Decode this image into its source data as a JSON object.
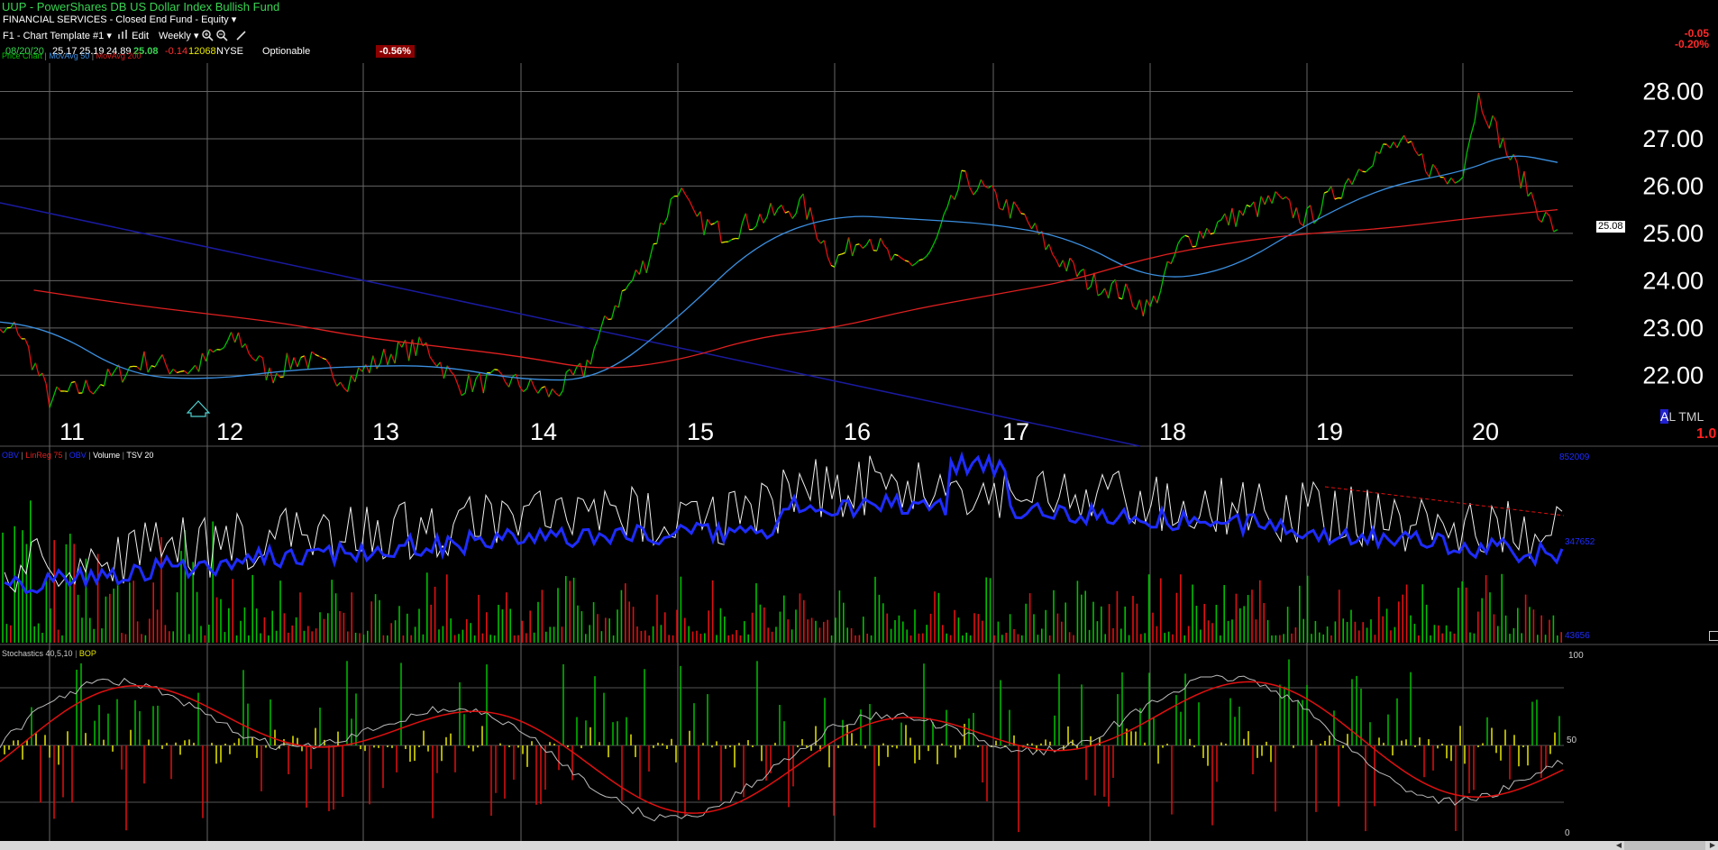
{
  "header": {
    "title": "UUP - PowerShares DB US Dollar Index Bullish Fund",
    "sector": "FINANCIAL SERVICES - Closed End Fund - Equity",
    "template": "F1 - Chart Template #1",
    "edit_label": "Edit",
    "period": "Weekly",
    "date": "08/20/20",
    "open": "25.17",
    "high": "25.19",
    "low": "24.89",
    "close": "25.08",
    "change": "-0.14",
    "volume": "12068",
    "exchange": "NYSE",
    "optionable": "Optionable",
    "pct_change": "-0.56%",
    "right_change": "-0.05",
    "right_pct": "-0.20%",
    "sector_dropdown": "▾",
    "template_dropdown": "▾",
    "period_dropdown": "▾"
  },
  "colors": {
    "up": "#00c000",
    "down": "#e01010",
    "neutral": "#e8e800",
    "ma50": "#3b8fe0",
    "ma200": "#e02020",
    "obv": "#1e2cff",
    "trend": "#1a1aa0"
  },
  "price_panel": {
    "legend": {
      "price": "Price Chart",
      "ma50": "MovAvg 50",
      "ma200": "MovAvg 200"
    },
    "last_price_tag": "25.08",
    "ticker_tag_a": "A",
    "ticker_tag_rest": "L TML",
    "ticker_tag_num": "1.0"
  },
  "volume_panel": {
    "legend": {
      "obv1": "OBV",
      "linreg": "LinReg 75",
      "obv2": "OBV",
      "volume": "Volume",
      "tsv": "TSV 20"
    },
    "top_label": "852009",
    "mid_label": "347652",
    "bottom_label": "43656"
  },
  "stoch_panel": {
    "legend": {
      "stoch": "Stochastics 40,5,10",
      "bop": "BOP"
    },
    "levels": [
      "100",
      "50",
      "0"
    ]
  },
  "chart_data": {
    "type": "line",
    "x_ticks": [
      "11",
      "12",
      "13",
      "14",
      "15",
      "16",
      "17",
      "18",
      "19",
      "20"
    ],
    "y_ticks": [
      "28.00",
      "27.00",
      "26.00",
      "25.00",
      "24.00",
      "23.00",
      "22.00"
    ],
    "ylim": [
      20.5,
      28.6
    ],
    "grid": true,
    "series": [
      {
        "name": "Price Chart",
        "x": [
          2010.5,
          2010.8,
          2011.0,
          2011.3,
          2011.6,
          2011.9,
          2012.2,
          2012.4,
          2012.6,
          2012.9,
          2013.2,
          2013.4,
          2013.6,
          2013.9,
          2014.2,
          2014.4,
          2014.6,
          2014.8,
          2015.0,
          2015.1,
          2015.3,
          2015.5,
          2015.8,
          2016.0,
          2016.2,
          2016.4,
          2016.6,
          2016.8,
          2016.9,
          2017.2,
          2017.4,
          2017.6,
          2017.8,
          2018.0,
          2018.2,
          2018.5,
          2018.8,
          2019.0,
          2019.2,
          2019.4,
          2019.6,
          2019.9,
          2020.0,
          2020.1,
          2020.3,
          2020.5,
          2020.6
        ],
        "values": [
          22.6,
          23.0,
          21.5,
          21.8,
          22.3,
          22.1,
          22.8,
          22.0,
          22.4,
          21.9,
          22.5,
          22.6,
          21.8,
          21.9,
          21.6,
          22.1,
          23.5,
          24.4,
          26.0,
          25.3,
          25.0,
          25.3,
          25.6,
          24.4,
          25.0,
          24.3,
          24.5,
          26.1,
          26.0,
          25.3,
          24.5,
          24.0,
          23.8,
          23.4,
          24.8,
          25.3,
          25.7,
          25.3,
          25.9,
          26.6,
          26.9,
          26.1,
          26.4,
          27.9,
          26.6,
          25.4,
          25.08
        ]
      },
      {
        "name": "MovAvg 50",
        "x": [
          2010.5,
          2011.0,
          2011.5,
          2012.0,
          2012.5,
          2013.0,
          2013.5,
          2014.0,
          2014.5,
          2015.0,
          2015.5,
          2016.0,
          2016.5,
          2017.0,
          2017.5,
          2018.0,
          2018.5,
          2019.0,
          2019.5,
          2020.0,
          2020.3,
          2020.6
        ],
        "values": [
          23.2,
          23.0,
          22.0,
          21.9,
          22.1,
          22.2,
          22.2,
          21.9,
          21.9,
          23.2,
          24.8,
          25.4,
          25.3,
          25.2,
          24.9,
          24.0,
          24.2,
          25.2,
          26.0,
          26.3,
          26.7,
          26.5
        ]
      },
      {
        "name": "MovAvg 200",
        "x": [
          2010.9,
          2011.5,
          2012.0,
          2012.5,
          2013.0,
          2013.5,
          2014.0,
          2014.5,
          2015.0,
          2015.5,
          2016.0,
          2016.5,
          2017.0,
          2017.5,
          2018.0,
          2018.5,
          2019.0,
          2019.5,
          2020.0,
          2020.3,
          2020.6
        ],
        "values": [
          23.8,
          23.5,
          23.3,
          23.1,
          22.8,
          22.6,
          22.4,
          22.1,
          22.3,
          22.8,
          23.0,
          23.4,
          23.7,
          24.0,
          24.5,
          24.8,
          25.0,
          25.1,
          25.3,
          25.4,
          25.5
        ]
      }
    ]
  }
}
